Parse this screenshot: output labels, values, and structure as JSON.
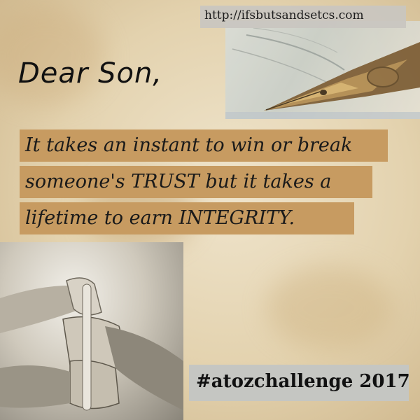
{
  "url": "http://ifsbutsandsetcs.com",
  "greeting": "Dear Son,",
  "quote": {
    "line1": "It takes an instant to win or break",
    "line2": "someone's TRUST but it takes a",
    "line3": "lifetime to earn INTEGRITY."
  },
  "hashtag": "#atozchallenge 2017",
  "colors": {
    "paper": "#e6d6b4",
    "quote_highlight": "#c79b61",
    "hashtag_box": "#c5c6c2"
  },
  "images": {
    "top_right": "fountain-pen-nib-photo",
    "bottom_left": "hands-holding-thumbs-photo"
  }
}
